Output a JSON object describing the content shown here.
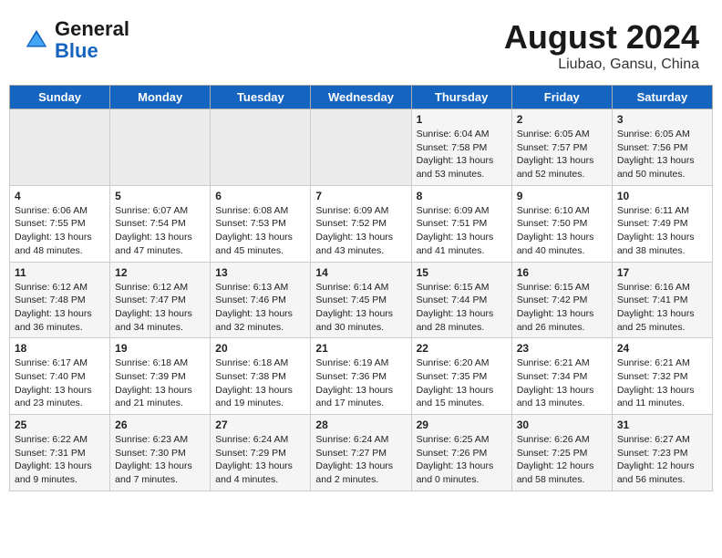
{
  "header": {
    "logo_general": "General",
    "logo_blue": "Blue",
    "title": "August 2024",
    "subtitle": "Liubao, Gansu, China"
  },
  "days_of_week": [
    "Sunday",
    "Monday",
    "Tuesday",
    "Wednesday",
    "Thursday",
    "Friday",
    "Saturday"
  ],
  "weeks": [
    {
      "days": [
        {
          "number": "",
          "empty": true
        },
        {
          "number": "",
          "empty": true
        },
        {
          "number": "",
          "empty": true
        },
        {
          "number": "",
          "empty": true
        },
        {
          "number": "1",
          "info": "Sunrise: 6:04 AM\nSunset: 7:58 PM\nDaylight: 13 hours\nand 53 minutes."
        },
        {
          "number": "2",
          "info": "Sunrise: 6:05 AM\nSunset: 7:57 PM\nDaylight: 13 hours\nand 52 minutes."
        },
        {
          "number": "3",
          "info": "Sunrise: 6:05 AM\nSunset: 7:56 PM\nDaylight: 13 hours\nand 50 minutes."
        }
      ]
    },
    {
      "days": [
        {
          "number": "4",
          "info": "Sunrise: 6:06 AM\nSunset: 7:55 PM\nDaylight: 13 hours\nand 48 minutes."
        },
        {
          "number": "5",
          "info": "Sunrise: 6:07 AM\nSunset: 7:54 PM\nDaylight: 13 hours\nand 47 minutes."
        },
        {
          "number": "6",
          "info": "Sunrise: 6:08 AM\nSunset: 7:53 PM\nDaylight: 13 hours\nand 45 minutes."
        },
        {
          "number": "7",
          "info": "Sunrise: 6:09 AM\nSunset: 7:52 PM\nDaylight: 13 hours\nand 43 minutes."
        },
        {
          "number": "8",
          "info": "Sunrise: 6:09 AM\nSunset: 7:51 PM\nDaylight: 13 hours\nand 41 minutes."
        },
        {
          "number": "9",
          "info": "Sunrise: 6:10 AM\nSunset: 7:50 PM\nDaylight: 13 hours\nand 40 minutes."
        },
        {
          "number": "10",
          "info": "Sunrise: 6:11 AM\nSunset: 7:49 PM\nDaylight: 13 hours\nand 38 minutes."
        }
      ]
    },
    {
      "days": [
        {
          "number": "11",
          "info": "Sunrise: 6:12 AM\nSunset: 7:48 PM\nDaylight: 13 hours\nand 36 minutes."
        },
        {
          "number": "12",
          "info": "Sunrise: 6:12 AM\nSunset: 7:47 PM\nDaylight: 13 hours\nand 34 minutes."
        },
        {
          "number": "13",
          "info": "Sunrise: 6:13 AM\nSunset: 7:46 PM\nDaylight: 13 hours\nand 32 minutes."
        },
        {
          "number": "14",
          "info": "Sunrise: 6:14 AM\nSunset: 7:45 PM\nDaylight: 13 hours\nand 30 minutes."
        },
        {
          "number": "15",
          "info": "Sunrise: 6:15 AM\nSunset: 7:44 PM\nDaylight: 13 hours\nand 28 minutes."
        },
        {
          "number": "16",
          "info": "Sunrise: 6:15 AM\nSunset: 7:42 PM\nDaylight: 13 hours\nand 26 minutes."
        },
        {
          "number": "17",
          "info": "Sunrise: 6:16 AM\nSunset: 7:41 PM\nDaylight: 13 hours\nand 25 minutes."
        }
      ]
    },
    {
      "days": [
        {
          "number": "18",
          "info": "Sunrise: 6:17 AM\nSunset: 7:40 PM\nDaylight: 13 hours\nand 23 minutes."
        },
        {
          "number": "19",
          "info": "Sunrise: 6:18 AM\nSunset: 7:39 PM\nDaylight: 13 hours\nand 21 minutes."
        },
        {
          "number": "20",
          "info": "Sunrise: 6:18 AM\nSunset: 7:38 PM\nDaylight: 13 hours\nand 19 minutes."
        },
        {
          "number": "21",
          "info": "Sunrise: 6:19 AM\nSunset: 7:36 PM\nDaylight: 13 hours\nand 17 minutes."
        },
        {
          "number": "22",
          "info": "Sunrise: 6:20 AM\nSunset: 7:35 PM\nDaylight: 13 hours\nand 15 minutes."
        },
        {
          "number": "23",
          "info": "Sunrise: 6:21 AM\nSunset: 7:34 PM\nDaylight: 13 hours\nand 13 minutes."
        },
        {
          "number": "24",
          "info": "Sunrise: 6:21 AM\nSunset: 7:32 PM\nDaylight: 13 hours\nand 11 minutes."
        }
      ]
    },
    {
      "days": [
        {
          "number": "25",
          "info": "Sunrise: 6:22 AM\nSunset: 7:31 PM\nDaylight: 13 hours\nand 9 minutes."
        },
        {
          "number": "26",
          "info": "Sunrise: 6:23 AM\nSunset: 7:30 PM\nDaylight: 13 hours\nand 7 minutes."
        },
        {
          "number": "27",
          "info": "Sunrise: 6:24 AM\nSunset: 7:29 PM\nDaylight: 13 hours\nand 4 minutes."
        },
        {
          "number": "28",
          "info": "Sunrise: 6:24 AM\nSunset: 7:27 PM\nDaylight: 13 hours\nand 2 minutes."
        },
        {
          "number": "29",
          "info": "Sunrise: 6:25 AM\nSunset: 7:26 PM\nDaylight: 13 hours\nand 0 minutes."
        },
        {
          "number": "30",
          "info": "Sunrise: 6:26 AM\nSunset: 7:25 PM\nDaylight: 12 hours\nand 58 minutes."
        },
        {
          "number": "31",
          "info": "Sunrise: 6:27 AM\nSunset: 7:23 PM\nDaylight: 12 hours\nand 56 minutes."
        }
      ]
    }
  ]
}
